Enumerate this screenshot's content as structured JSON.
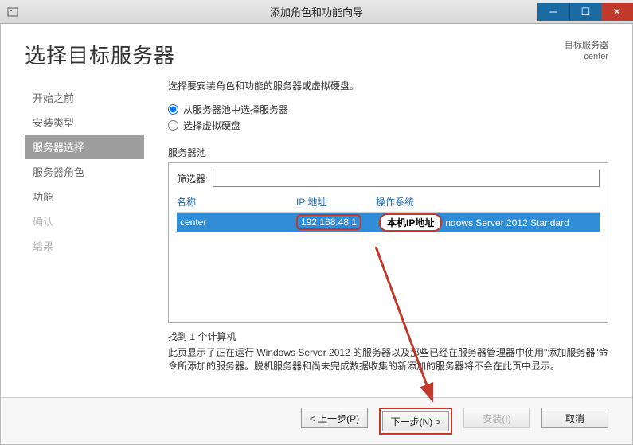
{
  "window": {
    "title": "添加角色和功能向导"
  },
  "header": {
    "title": "选择目标服务器",
    "dest_label": "目标服务器",
    "dest_value": "center"
  },
  "sidebar": {
    "steps": [
      {
        "label": "开始之前",
        "state": "normal"
      },
      {
        "label": "安装类型",
        "state": "normal"
      },
      {
        "label": "服务器选择",
        "state": "active"
      },
      {
        "label": "服务器角色",
        "state": "normal"
      },
      {
        "label": "功能",
        "state": "normal"
      },
      {
        "label": "确认",
        "state": "disabled"
      },
      {
        "label": "结果",
        "state": "disabled"
      }
    ]
  },
  "main": {
    "instruction": "选择要安装角色和功能的服务器或虚拟硬盘。",
    "radio1": "从服务器池中选择服务器",
    "radio2": "选择虚拟硬盘",
    "radio_selected": 0,
    "pool_label": "服务器池",
    "filter_label": "筛选器:",
    "filter_value": "",
    "columns": {
      "name": "名称",
      "ip": "IP 地址",
      "os": "操作系统"
    },
    "rows": [
      {
        "name": "center",
        "ip": "192.168.48.1",
        "os_suffix": "ndows Server 2012 Standard"
      }
    ],
    "annotation_note": "本机IP地址",
    "found_text": "找到 1 个计算机",
    "description": "此页显示了正在运行 Windows Server 2012 的服务器以及那些已经在服务器管理器中使用\"添加服务器\"命令所添加的服务器。脱机服务器和尚未完成数据收集的新添加的服务器将不会在此页中显示。"
  },
  "footer": {
    "prev": "< 上一步(P)",
    "next": "下一步(N) >",
    "install": "安装(I)",
    "cancel": "取消"
  }
}
